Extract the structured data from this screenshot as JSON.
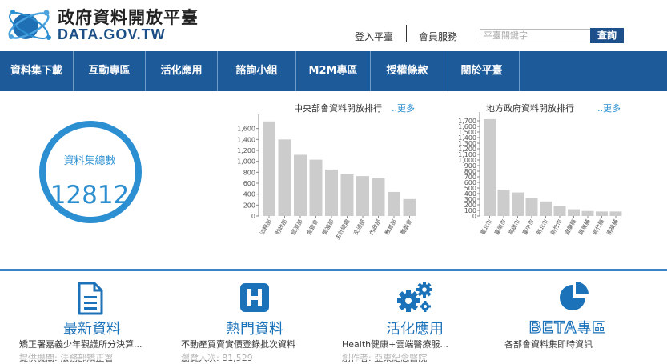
{
  "header": {
    "site_name_cn": "政府資料開放平臺",
    "site_name_en": "DATA.GOV.TW",
    "login": "登入平臺",
    "member": "會員服務",
    "search_placeholder": "平臺關鍵字",
    "search_button": "查詢"
  },
  "nav": [
    "資料集下載",
    "互動專區",
    "活化應用",
    "諮詢小組",
    "M2M專區",
    "授權條款",
    "關於平臺"
  ],
  "stats": {
    "total_label": "資料集總數",
    "total_value": "12812"
  },
  "more_label": "..更多",
  "chart_data": [
    {
      "type": "bar",
      "title": "中央部會資料開放排行",
      "categories": [
        "法務部",
        "財政部",
        "經濟部",
        "金管會",
        "衛福部",
        "主計總處",
        "交通部",
        "內政部",
        "教育部",
        "農委會"
      ],
      "values": [
        1730,
        1400,
        1120,
        1030,
        850,
        770,
        730,
        690,
        440,
        310
      ],
      "ylim": [
        0,
        1800
      ],
      "yticks": [
        0,
        200,
        400,
        600,
        800,
        1000,
        1200,
        1400,
        1600
      ],
      "ytick_labels": [
        "0",
        "200",
        "400",
        "600",
        "800",
        "1,000",
        "1,200",
        "1,400",
        "1,600"
      ],
      "grid": false,
      "color": "#cccccc"
    },
    {
      "type": "bar",
      "title": "地方政府資料開放排行",
      "categories": [
        "臺北市",
        "臺南市",
        "高雄市",
        "臺中市",
        "新北市",
        "新竹市",
        "宜蘭縣",
        "屏東縣",
        "新竹縣",
        "南投縣"
      ],
      "values": [
        1730,
        470,
        420,
        320,
        260,
        180,
        120,
        90,
        80,
        80
      ],
      "ylim": [
        0,
        1800
      ],
      "yticks": [
        0,
        100,
        200,
        300,
        400,
        500,
        600,
        700,
        800,
        900,
        1000,
        1100,
        1200,
        1300,
        1400,
        1500,
        1600,
        1700
      ],
      "ytick_labels": [
        "0",
        "100",
        "200",
        "300",
        "400",
        "500",
        "600",
        "700",
        "800",
        "900",
        "1,000",
        "1,100",
        "1,200",
        "1,300",
        "1,400",
        "1,500",
        "1,600",
        "1,700"
      ],
      "grid": false,
      "color": "#cccccc"
    }
  ],
  "features": [
    {
      "title": "最新資料",
      "subtitle": "矯正署嘉義少年觀護所分決算...",
      "meta": "提供機關: 法務部矯正署",
      "icon": "document-icon"
    },
    {
      "title": "熱門資料",
      "subtitle": "不動產買賣實價登錄批次資料",
      "meta": "瀏覽人次: 81,529",
      "icon": "hot-h-icon"
    },
    {
      "title": "活化應用",
      "subtitle": "Health健康+雲端醫療服...",
      "meta": "創作者: 亞東紀念醫院",
      "icon": "gears-icon"
    },
    {
      "title_badge": "BETA",
      "title": "專區",
      "subtitle": "各部會資料集即時資訊",
      "icon": "pie-chart-icon"
    }
  ],
  "colors": {
    "nav_bg": "#1d5a9a",
    "accent": "#2b8fd2",
    "bar": "#cccccc",
    "search_button": "#1d4f8a"
  }
}
